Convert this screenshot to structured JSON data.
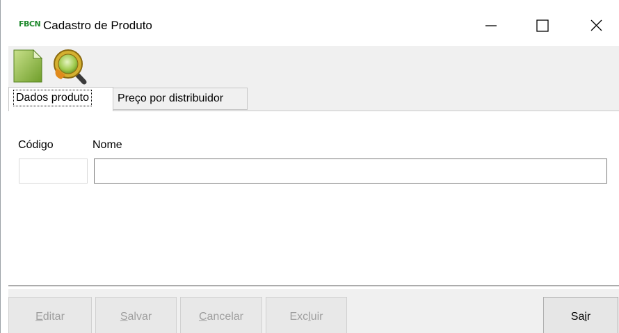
{
  "window": {
    "app_icon_text": "FBCN",
    "title": "Cadastro de Produto"
  },
  "toolbar": {
    "icons": [
      "new-document-icon",
      "search-icon"
    ]
  },
  "tabs": [
    {
      "label": "Dados produto",
      "active": true
    },
    {
      "label": "Preço por distribuidor",
      "active": false
    }
  ],
  "form": {
    "codigo": {
      "label": "Código",
      "value": ""
    },
    "nome": {
      "label": "Nome",
      "value": ""
    }
  },
  "actions": {
    "editar": {
      "accel": "E",
      "rest": "ditar",
      "enabled": false
    },
    "salvar": {
      "accel": "S",
      "rest": "alvar",
      "enabled": false
    },
    "cancelar": {
      "accel": "C",
      "rest": "ancelar",
      "enabled": false
    },
    "excluir": {
      "pre": "Exc",
      "accel": "l",
      "rest": "uir",
      "enabled": false
    },
    "sair": {
      "pre": "Sa",
      "accel": "i",
      "rest": "r",
      "enabled": true
    }
  },
  "colors": {
    "app_icon": "#1f8a2d",
    "disabled_text": "#9e9e9e",
    "panel_bg": "#f0f0f0"
  }
}
